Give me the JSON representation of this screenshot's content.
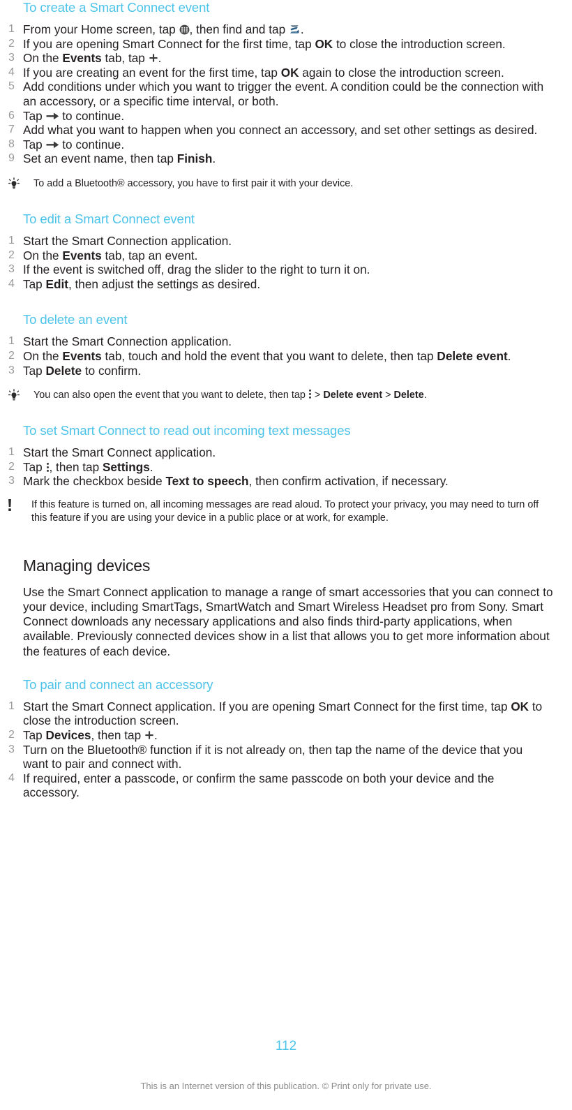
{
  "page": {
    "number": "112",
    "footer_note": "This is an Internet version of this publication. © Print only for private use.",
    "accent_color": "#4cc3e9",
    "text_color": "#231f20",
    "number_color": "#9a9a9a",
    "footer_color": "#8c8c8c"
  },
  "icons": {
    "app_drawer": "app-drawer-icon",
    "smart_connect": "smart-connect-app-icon",
    "plus": "plus-icon",
    "arrow_right": "arrow-right-icon",
    "overflow_dots": "more-options-vertical-dots-icon",
    "tip": "lightbulb-tip-icon",
    "warning": "exclamation-note-icon"
  },
  "sections": [
    {
      "id": "create-event",
      "heading": "To create a Smart Connect event",
      "steps": [
        {
          "n": "1",
          "parts": [
            {
              "t": "text",
              "v": "From your Home screen, tap "
            },
            {
              "t": "icon",
              "v": "app-drawer-icon"
            },
            {
              "t": "text",
              "v": ", then find and tap "
            },
            {
              "t": "icon",
              "v": "smart-connect-app-icon"
            },
            {
              "t": "text",
              "v": "."
            }
          ]
        },
        {
          "n": "2",
          "parts": [
            {
              "t": "text",
              "v": "If you are opening Smart Connect for the first time, tap "
            },
            {
              "t": "bold",
              "v": "OK"
            },
            {
              "t": "text",
              "v": " to close the introduction screen."
            }
          ]
        },
        {
          "n": "3",
          "parts": [
            {
              "t": "text",
              "v": "On the "
            },
            {
              "t": "bold",
              "v": "Events"
            },
            {
              "t": "text",
              "v": " tab, tap "
            },
            {
              "t": "icon",
              "v": "plus-icon"
            },
            {
              "t": "text",
              "v": "."
            }
          ]
        },
        {
          "n": "4",
          "parts": [
            {
              "t": "text",
              "v": "If you are creating an event for the first time, tap "
            },
            {
              "t": "bold",
              "v": "OK"
            },
            {
              "t": "text",
              "v": " again to close the introduction screen."
            }
          ]
        },
        {
          "n": "5",
          "parts": [
            {
              "t": "text",
              "v": "Add conditions under which you want to trigger the event. A condition could be the connection with an accessory, or a specific time interval, or both."
            }
          ]
        },
        {
          "n": "6",
          "parts": [
            {
              "t": "text",
              "v": "Tap "
            },
            {
              "t": "icon",
              "v": "arrow-right-icon"
            },
            {
              "t": "text",
              "v": " to continue."
            }
          ]
        },
        {
          "n": "7",
          "parts": [
            {
              "t": "text",
              "v": "Add what you want to happen when you connect an accessory, and set other settings as desired."
            }
          ]
        },
        {
          "n": "8",
          "parts": [
            {
              "t": "text",
              "v": "Tap "
            },
            {
              "t": "icon",
              "v": "arrow-right-icon"
            },
            {
              "t": "text",
              "v": " to continue."
            }
          ]
        },
        {
          "n": "9",
          "parts": [
            {
              "t": "text",
              "v": "Set an event name, then tap "
            },
            {
              "t": "bold",
              "v": "Finish"
            },
            {
              "t": "text",
              "v": "."
            }
          ]
        }
      ],
      "note": {
        "kind": "tip",
        "parts": [
          {
            "t": "text",
            "v": "To add a Bluetooth® accessory, you have to first pair it with your device."
          }
        ]
      }
    },
    {
      "id": "edit-event",
      "heading": "To edit a Smart Connect event",
      "steps": [
        {
          "n": "1",
          "parts": [
            {
              "t": "text",
              "v": "Start the Smart Connection application."
            }
          ]
        },
        {
          "n": "2",
          "parts": [
            {
              "t": "text",
              "v": "On the "
            },
            {
              "t": "bold",
              "v": "Events"
            },
            {
              "t": "text",
              "v": " tab, tap an event."
            }
          ]
        },
        {
          "n": "3",
          "parts": [
            {
              "t": "text",
              "v": "If the event is switched off, drag the slider to the right to turn it on."
            }
          ]
        },
        {
          "n": "4",
          "parts": [
            {
              "t": "text",
              "v": "Tap "
            },
            {
              "t": "bold",
              "v": "Edit"
            },
            {
              "t": "text",
              "v": ", then adjust the settings as desired."
            }
          ]
        }
      ]
    },
    {
      "id": "delete-event",
      "heading": "To delete an event",
      "steps": [
        {
          "n": "1",
          "parts": [
            {
              "t": "text",
              "v": "Start the Smart Connection application."
            }
          ]
        },
        {
          "n": "2",
          "parts": [
            {
              "t": "text",
              "v": "On the "
            },
            {
              "t": "bold",
              "v": "Events"
            },
            {
              "t": "text",
              "v": " tab, touch and hold the event that you want to delete, then tap "
            },
            {
              "t": "bold",
              "v": "Delete event"
            },
            {
              "t": "text",
              "v": "."
            }
          ]
        },
        {
          "n": "3",
          "parts": [
            {
              "t": "text",
              "v": "Tap "
            },
            {
              "t": "bold",
              "v": "Delete"
            },
            {
              "t": "text",
              "v": " to confirm."
            }
          ]
        }
      ],
      "note": {
        "kind": "tip",
        "parts": [
          {
            "t": "text",
            "v": "You can also open the event that you want to delete, then tap "
          },
          {
            "t": "icon",
            "v": "more-options-vertical-dots-icon"
          },
          {
            "t": "text",
            "v": " > "
          },
          {
            "t": "bold",
            "v": "Delete event"
          },
          {
            "t": "text",
            "v": " > "
          },
          {
            "t": "bold",
            "v": "Delete"
          },
          {
            "t": "text",
            "v": "."
          }
        ]
      }
    },
    {
      "id": "read-out-texts",
      "heading": "To set Smart Connect to read out incoming text messages",
      "steps": [
        {
          "n": "1",
          "parts": [
            {
              "t": "text",
              "v": "Start the Smart Connect application."
            }
          ]
        },
        {
          "n": "2",
          "parts": [
            {
              "t": "text",
              "v": "Tap "
            },
            {
              "t": "icon",
              "v": "more-options-vertical-dots-icon"
            },
            {
              "t": "text",
              "v": ", then tap "
            },
            {
              "t": "bold",
              "v": "Settings"
            },
            {
              "t": "text",
              "v": "."
            }
          ]
        },
        {
          "n": "3",
          "parts": [
            {
              "t": "text",
              "v": "Mark the checkbox beside "
            },
            {
              "t": "bold",
              "v": "Text to speech"
            },
            {
              "t": "text",
              "v": ", then confirm activation, if necessary."
            }
          ]
        }
      ],
      "note": {
        "kind": "warning",
        "parts": [
          {
            "t": "text",
            "v": "If this feature is turned on, all incoming messages are read aloud. To protect your privacy, you may need to turn off this feature if you are using your device in a public place or at work, for example."
          }
        ]
      }
    }
  ],
  "managing_devices": {
    "heading": "Managing devices",
    "paragraph": "Use the Smart Connect application to manage a range of smart accessories that you can connect to your device, including SmartTags, SmartWatch and Smart Wireless Headset pro from Sony. Smart Connect downloads any necessary applications and also finds third-party applications, when available. Previously connected devices show in a list that allows you to get more information about the features of each device.",
    "subsection": {
      "id": "pair-connect",
      "heading": "To pair and connect an accessory",
      "steps": [
        {
          "n": "1",
          "parts": [
            {
              "t": "text",
              "v": "Start the Smart Connect application. If you are opening Smart Connect for the first time, tap "
            },
            {
              "t": "bold",
              "v": "OK"
            },
            {
              "t": "text",
              "v": " to close the introduction screen."
            }
          ]
        },
        {
          "n": "2",
          "parts": [
            {
              "t": "text",
              "v": "Tap "
            },
            {
              "t": "bold",
              "v": "Devices"
            },
            {
              "t": "text",
              "v": ", then tap "
            },
            {
              "t": "icon",
              "v": "plus-icon"
            },
            {
              "t": "text",
              "v": "."
            }
          ]
        },
        {
          "n": "3",
          "parts": [
            {
              "t": "text",
              "v": "Turn on the Bluetooth® function if it is not already on, then tap the name of the device that you want to pair and connect with."
            }
          ]
        },
        {
          "n": "4",
          "parts": [
            {
              "t": "text",
              "v": "If required, enter a passcode, or confirm the same passcode on both your device and the accessory."
            }
          ]
        }
      ]
    }
  }
}
